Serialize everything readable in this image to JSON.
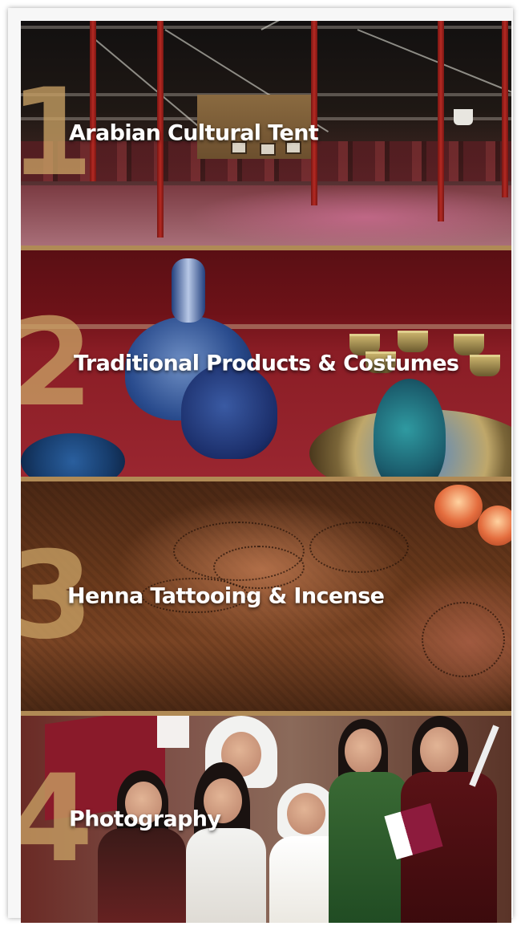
{
  "items": [
    {
      "number": "1",
      "title": "Arabian Cultural Tent"
    },
    {
      "number": "2",
      "title": "Traditional Products & Costumes"
    },
    {
      "number": "3",
      "title": "Henna Tattooing & Incense"
    },
    {
      "number": "4",
      "title": "Photography"
    }
  ],
  "colors": {
    "number_accent": "#c8a064",
    "title_text": "#ffffff",
    "divider": "#b08a55"
  }
}
